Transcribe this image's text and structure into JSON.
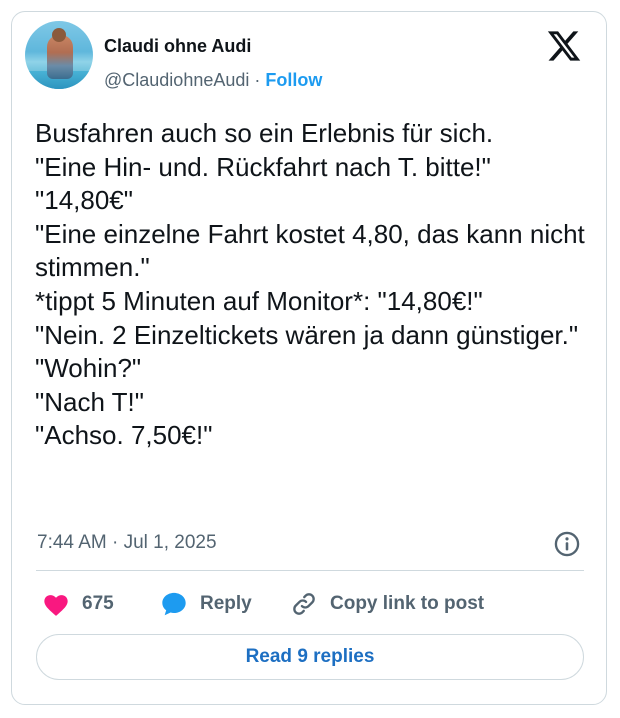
{
  "author": {
    "name": "Claudi ohne Audi",
    "handle": "@ClaudiohneAudi",
    "separator": "·",
    "follow_label": "Follow"
  },
  "tweet": {
    "text": "Busfahren auch so ein Erlebnis für sich.\n\"Eine Hin- und. Rückfahrt nach T. bitte!\"\n\"14,80€\"\n\"Eine einzelne Fahrt kostet 4,80, das kann nicht stimmen.\"\n*tippt 5 Minuten auf Monitor*: \"14,80€!\"\n\"Nein. 2 Einzeltickets wären ja dann günstiger.\"\n\"Wohin?\"\n\"Nach T!\"\n\"Achso. 7,50€!\"",
    "timestamp": "7:44 AM · Jul 1, 2025"
  },
  "actions": {
    "like_count": "675",
    "reply_label": "Reply",
    "copy_label": "Copy link to post"
  },
  "read_replies_label": "Read 9 replies",
  "icons": {
    "brand": "x-logo-icon",
    "like": "heart-icon",
    "reply": "speech-bubble-icon",
    "copy": "link-icon",
    "info": "info-icon"
  },
  "colors": {
    "like": "#f91880",
    "reply": "#1d9bf0",
    "link": "#1d9bf0",
    "secondary_text": "#536471",
    "border": "#cfd9de"
  }
}
